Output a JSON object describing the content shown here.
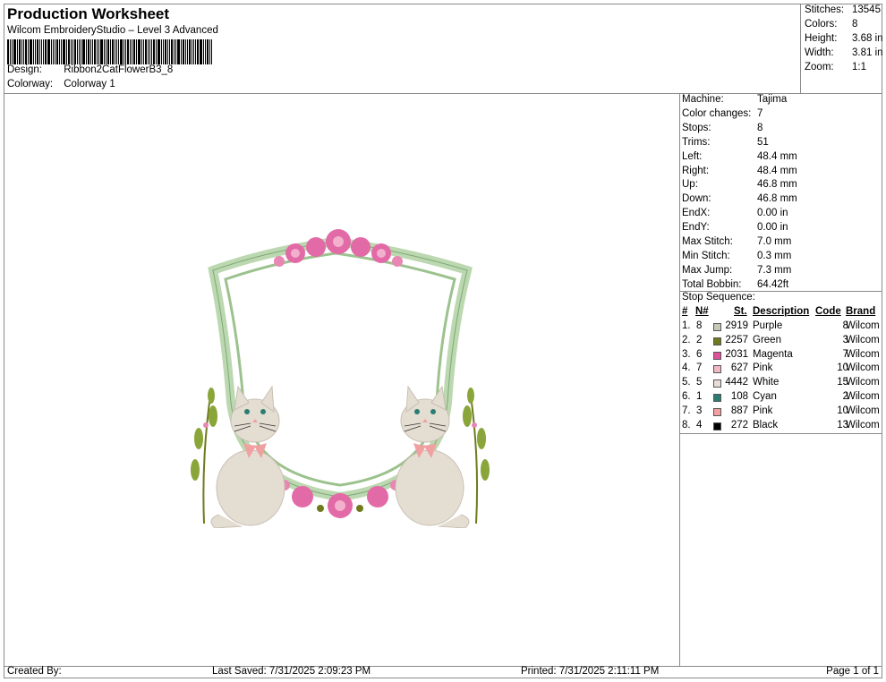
{
  "header": {
    "title": "Production Worksheet",
    "subtitle": "Wilcom EmbroideryStudio – Level 3 Advanced",
    "design_label": "Design:",
    "design_value": "Ribbon2CatFlowerB3_8",
    "colorway_label": "Colorway:",
    "colorway_value": "Colorway 1"
  },
  "summary": [
    {
      "label": "Stitches:",
      "value": "13545"
    },
    {
      "label": "Colors:",
      "value": "8"
    },
    {
      "label": "Height:",
      "value": "3.68 in"
    },
    {
      "label": "Width:",
      "value": "3.81 in"
    },
    {
      "label": "Zoom:",
      "value": "1:1"
    }
  ],
  "specs": [
    {
      "label": "Machine:",
      "value": "Tajima"
    },
    {
      "label": "Color changes:",
      "value": "7"
    },
    {
      "label": "Stops:",
      "value": "8"
    },
    {
      "label": "Trims:",
      "value": "51"
    },
    {
      "label": "Left:",
      "value": "48.4 mm"
    },
    {
      "label": "Right:",
      "value": "48.4 mm"
    },
    {
      "label": "Up:",
      "value": "46.8 mm"
    },
    {
      "label": "Down:",
      "value": "46.8 mm"
    },
    {
      "label": "EndX:",
      "value": "0.00 in"
    },
    {
      "label": "EndY:",
      "value": "0.00 in"
    },
    {
      "label": "Max Stitch:",
      "value": "7.0 mm"
    },
    {
      "label": "Min Stitch:",
      "value": "0.3 mm"
    },
    {
      "label": "Max Jump:",
      "value": "7.3 mm"
    },
    {
      "label": "Total Bobbin:",
      "value": "64.42ft"
    }
  ],
  "stop_sequence": {
    "title": "Stop Sequence:",
    "headers": {
      "num": "#",
      "n": "N#",
      "st": "St.",
      "desc": "Description",
      "code": "Code",
      "brand": "Brand"
    },
    "rows": [
      {
        "num": "1.",
        "n": "8",
        "color": "#c8c8b4",
        "st": "2919",
        "desc": "Purple",
        "code": "8",
        "brand": "Wilcom"
      },
      {
        "num": "2.",
        "n": "2",
        "color": "#6f7a1e",
        "st": "2257",
        "desc": "Green",
        "code": "3",
        "brand": "Wilcom"
      },
      {
        "num": "3.",
        "n": "6",
        "color": "#e0509a",
        "st": "2031",
        "desc": "Magenta",
        "code": "7",
        "brand": "Wilcom"
      },
      {
        "num": "4.",
        "n": "7",
        "color": "#f2b6c4",
        "st": "627",
        "desc": "Pink",
        "code": "10",
        "brand": "Wilcom"
      },
      {
        "num": "5.",
        "n": "5",
        "color": "#ecdcd8",
        "st": "4442",
        "desc": "White",
        "code": "15",
        "brand": "Wilcom"
      },
      {
        "num": "6.",
        "n": "1",
        "color": "#2a7d72",
        "st": "108",
        "desc": "Cyan",
        "code": "2",
        "brand": "Wilcom"
      },
      {
        "num": "7.",
        "n": "3",
        "color": "#f0a0a0",
        "st": "887",
        "desc": "Pink",
        "code": "10",
        "brand": "Wilcom"
      },
      {
        "num": "8.",
        "n": "4",
        "color": "#000000",
        "st": "272",
        "desc": "Black",
        "code": "13",
        "brand": "Wilcom"
      }
    ]
  },
  "footer": {
    "created": "Created By:",
    "saved": "Last Saved: 7/31/2025 2:09:23 PM",
    "printed": "Printed: 7/31/2025 2:11:11 PM",
    "page": "Page 1 of 1"
  },
  "colors": {
    "border": "#8a8a8a",
    "frame_green": "#bcd8b0",
    "fabric": "#e4ddd2"
  }
}
